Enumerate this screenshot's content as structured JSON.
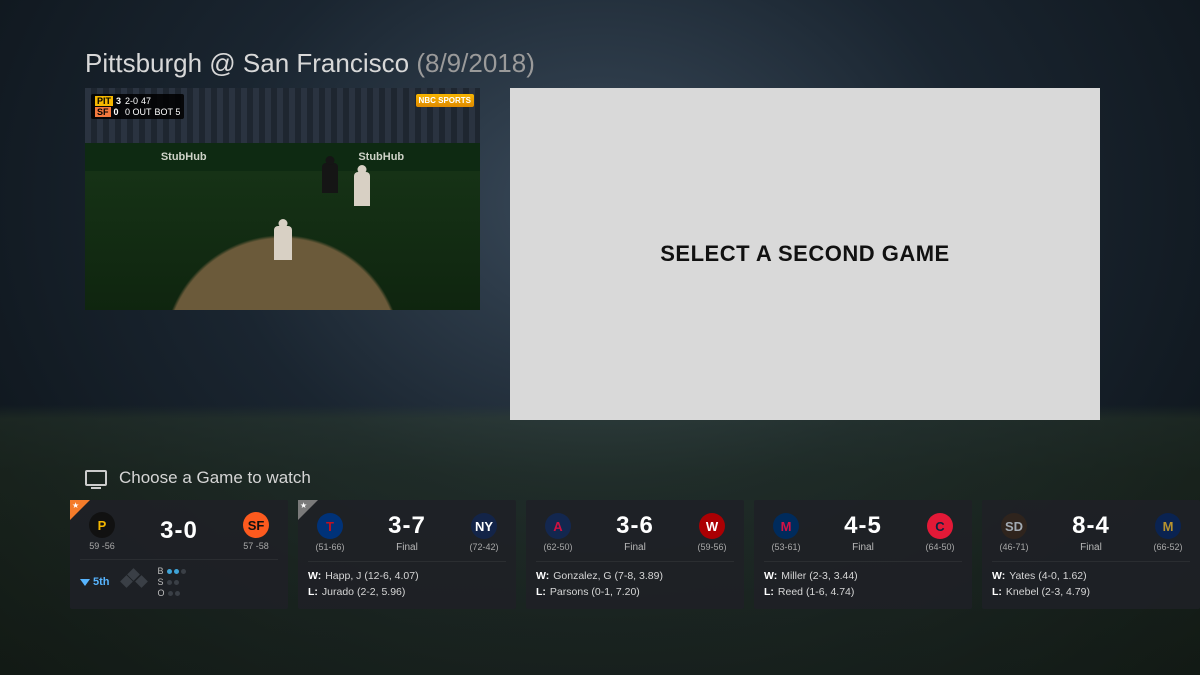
{
  "header": {
    "title": "Pittsburgh @ San Francisco",
    "date": "(8/9/2018)"
  },
  "placeholder_text": "SELECT A SECOND GAME",
  "choose_label": "Choose a Game to watch",
  "scorebug": {
    "away_abbr": "PIT",
    "away_score": "3",
    "home_abbr": "SF",
    "home_score": "0",
    "count": "2-0",
    "pitch": "47",
    "outs": "0 OUT",
    "inning": "BOT 5",
    "network": "NBC SPORTS"
  },
  "wall_ads": [
    "StubHub",
    "StubHub"
  ],
  "games": [
    {
      "live": true,
      "star": "orange",
      "away": {
        "abbr": "P",
        "cls": "PIT",
        "record": "59 -56"
      },
      "home": {
        "abbr": "SF",
        "cls": "SF",
        "record": "57 -58"
      },
      "score": "3-0",
      "status": "",
      "inning_half": "5th",
      "bases": {
        "b1": false,
        "b2": false,
        "b3": false
      },
      "bso": {
        "b": 2,
        "s": 0,
        "o": 0
      }
    },
    {
      "live": false,
      "star": "grey",
      "away": {
        "abbr": "T",
        "cls": "TEX",
        "record": "(51-66)"
      },
      "home": {
        "abbr": "NY",
        "cls": "NYY",
        "record": "(72-42)"
      },
      "score": "3-7",
      "status": "Final",
      "winner": "Happ, J (12-6, 4.07)",
      "loser": "Jurado (2-2, 5.96)"
    },
    {
      "live": false,
      "away": {
        "abbr": "A",
        "cls": "ATL",
        "record": "(62-50)"
      },
      "home": {
        "abbr": "W",
        "cls": "WSH",
        "record": "(59-56)"
      },
      "score": "3-6",
      "status": "Final",
      "winner": "Gonzalez, G (7-8, 3.89)",
      "loser": "Parsons (0-1, 7.20)"
    },
    {
      "live": false,
      "away": {
        "abbr": "M",
        "cls": "MIN",
        "record": "(53-61)"
      },
      "home": {
        "abbr": "C",
        "cls": "CLE",
        "record": "(64-50)"
      },
      "score": "4-5",
      "status": "Final",
      "winner": "Miller (2-3, 3.44)",
      "loser": "Reed (1-6, 4.74)"
    },
    {
      "live": false,
      "away": {
        "abbr": "SD",
        "cls": "SD",
        "record": "(46-71)"
      },
      "home": {
        "abbr": "M",
        "cls": "MIL",
        "record": "(66-52)"
      },
      "score": "8-4",
      "status": "Final",
      "winner": "Yates (4-0, 1.62)",
      "loser": "Knebel (2-3, 4.79)"
    }
  ]
}
